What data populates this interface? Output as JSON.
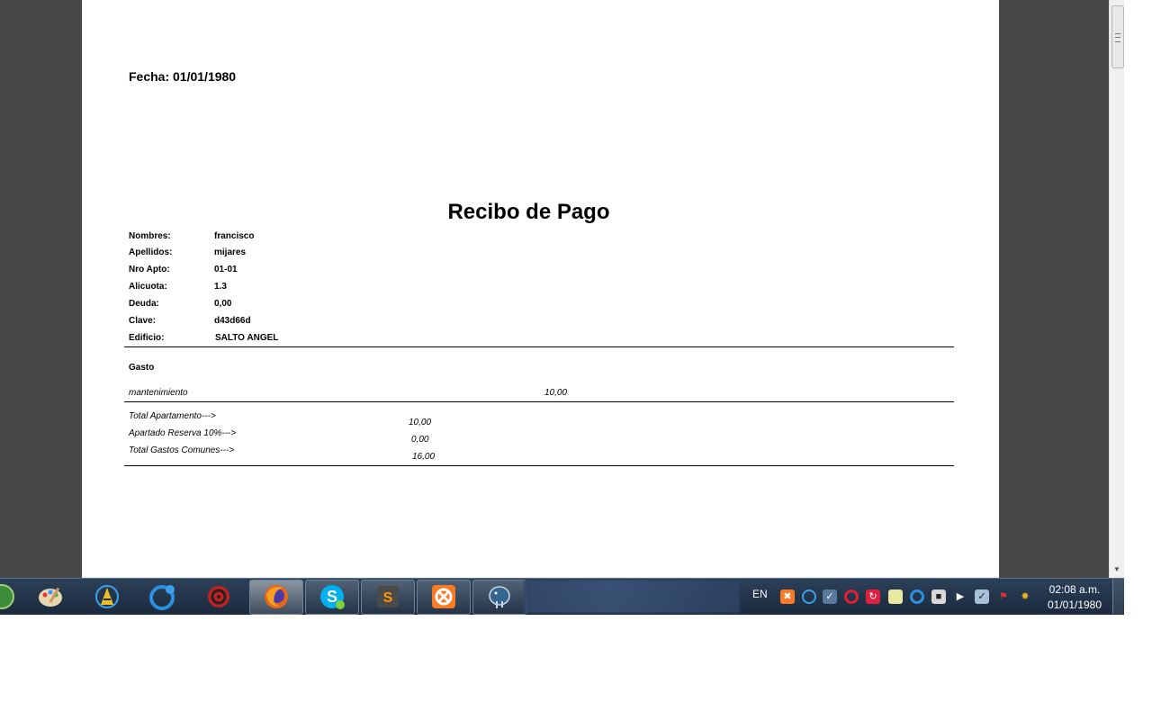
{
  "document": {
    "fecha": "Fecha: 01/01/1980",
    "title": "Recibo de Pago",
    "fields": [
      {
        "label": "Nombres:",
        "value": "francisco"
      },
      {
        "label": "Apellidos:",
        "value": "mijares"
      },
      {
        "label": "Nro Apto:",
        "value": "01-01"
      },
      {
        "label": "Alicuota:",
        "value": "1.3"
      },
      {
        "label": "Deuda:",
        "value": "0,00"
      },
      {
        "label": "Clave:",
        "value": "d43d66d"
      },
      {
        "label": "Edificio:",
        "value": "SALTO ANGEL"
      }
    ],
    "gasto_header": "Gasto",
    "gastos": [
      {
        "concepto": "mantenimiento",
        "monto": "10,00"
      }
    ],
    "totals": [
      {
        "label": "Total Apartamento--->",
        "value": "10,00"
      },
      {
        "label": "Apartado Reserva 10%--->",
        "value": "0,00"
      },
      {
        "label": "Total Gastos Comunes--->",
        "value": "16,00"
      }
    ]
  },
  "taskbar": {
    "language": "EN",
    "time": "02:08 a.m.",
    "date": "01/01/1980",
    "apps": [
      "start-orb",
      "paint",
      "app-a",
      "ccleaner",
      "gear-app",
      "firefox",
      "skype",
      "sublime-text",
      "xampp",
      "postgresql"
    ]
  }
}
